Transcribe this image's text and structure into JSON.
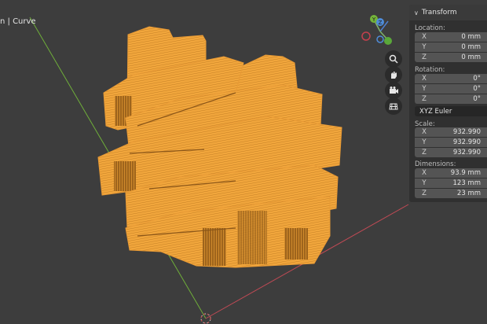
{
  "viewport": {
    "label": "n | Curve",
    "gizmo": {
      "x_label": "X",
      "y_label": "Y",
      "z_label": "Z"
    },
    "nav_tools": [
      "zoom-icon",
      "hand-icon",
      "camera-icon",
      "grid-icon"
    ]
  },
  "panel": {
    "title": "Transform",
    "location": {
      "label": "Location:",
      "rows": [
        {
          "axis": "X",
          "value": "0 mm"
        },
        {
          "axis": "Y",
          "value": "0 mm"
        },
        {
          "axis": "Z",
          "value": "0 mm"
        }
      ]
    },
    "rotation": {
      "label": "Rotation:",
      "rows": [
        {
          "axis": "X",
          "value": "0°"
        },
        {
          "axis": "Y",
          "value": "0°"
        },
        {
          "axis": "Z",
          "value": "0°"
        }
      ],
      "mode": "XYZ Euler"
    },
    "scale": {
      "label": "Scale:",
      "rows": [
        {
          "axis": "X",
          "value": "932.990"
        },
        {
          "axis": "Y",
          "value": "932.990"
        },
        {
          "axis": "Z",
          "value": "932.990"
        }
      ]
    },
    "dimensions": {
      "label": "Dimensions:",
      "rows": [
        {
          "axis": "X",
          "value": "93.9 mm"
        },
        {
          "axis": "Y",
          "value": "123 mm"
        },
        {
          "axis": "Z",
          "value": "23 mm"
        }
      ]
    }
  },
  "colors": {
    "background": "#3d3d3d",
    "object_fill": "#f0a43a",
    "object_dark": "#8a5518",
    "y_axis_line": "#6fae3a",
    "x_axis_line": "#c04a55"
  }
}
